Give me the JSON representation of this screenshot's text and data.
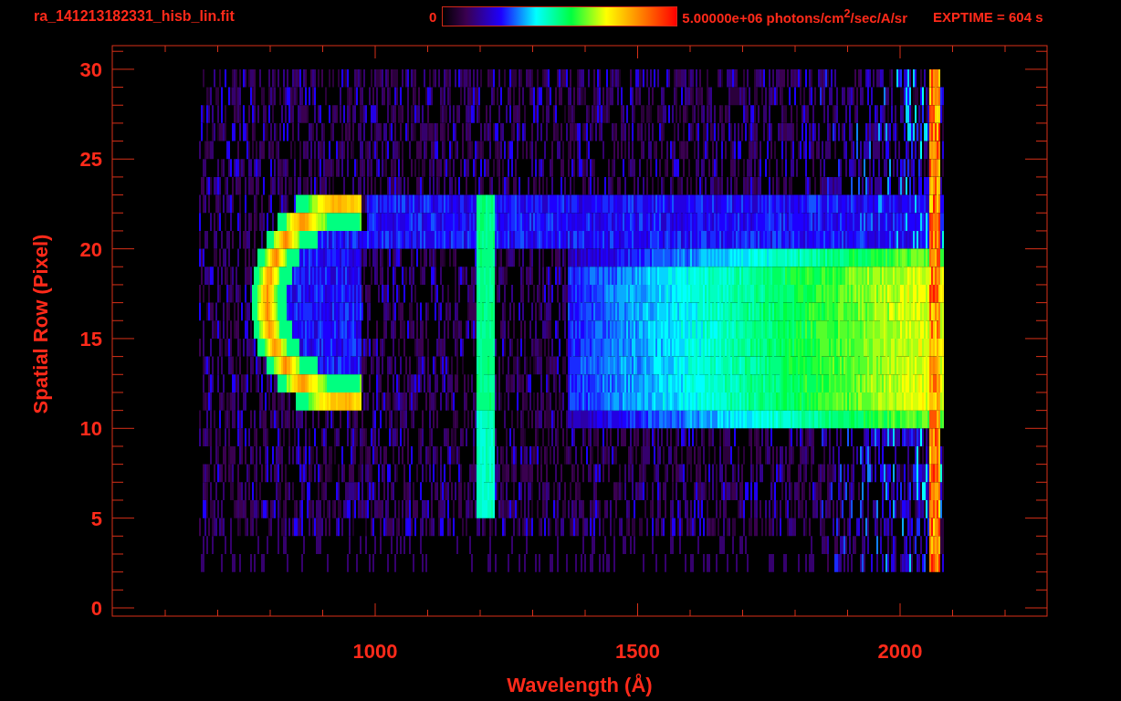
{
  "title": "ra_141213182331_hisb_lin.fit",
  "colorbar": {
    "min_label": "0",
    "max_label": "5.00000e+06 photons/cm$^{2}$/sec/A/sr"
  },
  "exposure": "EXPTIME = 604 s",
  "y_axis": {
    "label": "Spatial Row (Pixel)",
    "ticks": [
      "30",
      "25",
      "20",
      "15",
      "10",
      "5",
      "0"
    ]
  },
  "x_axis": {
    "label": "Wavelength (Å)",
    "ticks": [
      "1000",
      "1500",
      "2000"
    ]
  }
}
